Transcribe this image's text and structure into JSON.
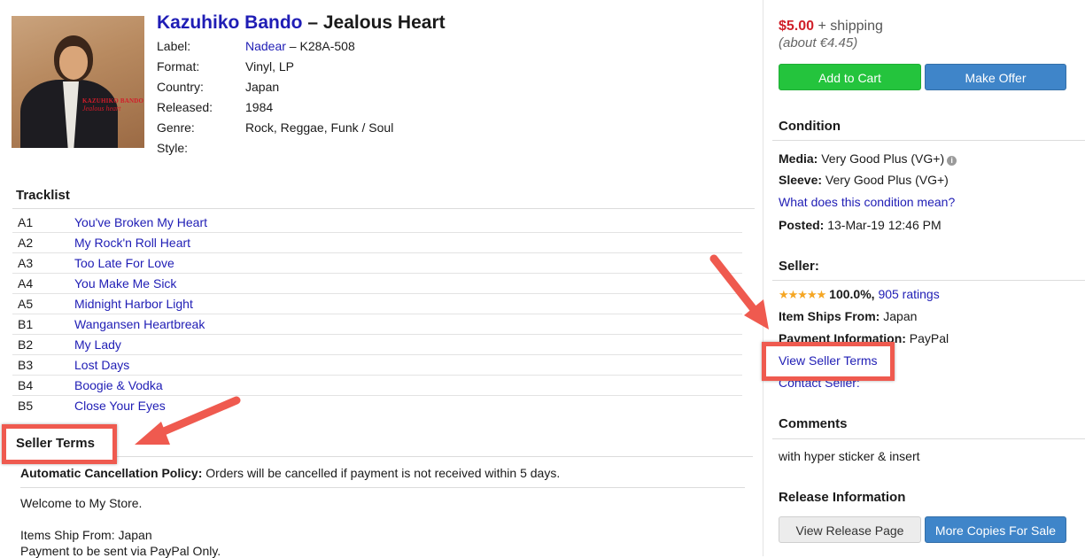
{
  "release": {
    "artist": "Kazuhiko Bando",
    "separator": " – ",
    "title": "Jealous Heart",
    "cover": {
      "artist_text": "KAZUHIKO BANDO",
      "title_text": "Jealous heart"
    },
    "meta": [
      {
        "key": "Label:",
        "value_link": "Nadear",
        "value_rest": " – K28A-508"
      },
      {
        "key": "Format:",
        "value": "Vinyl, LP"
      },
      {
        "key": "Country:",
        "value": "Japan"
      },
      {
        "key": "Released:",
        "value": "1984"
      },
      {
        "key": "Genre:",
        "value": "Rock, Reggae, Funk / Soul"
      },
      {
        "key": "Style:",
        "value": ""
      }
    ]
  },
  "tracklist": {
    "heading": "Tracklist",
    "tracks": [
      {
        "pos": "A1",
        "title": "You've Broken My Heart"
      },
      {
        "pos": "A2",
        "title": "My Rock'n Roll Heart"
      },
      {
        "pos": "A3",
        "title": "Too Late For Love"
      },
      {
        "pos": "A4",
        "title": "You Make Me Sick"
      },
      {
        "pos": "A5",
        "title": "Midnight Harbor Light"
      },
      {
        "pos": "B1",
        "title": "Wangansen Heartbreak"
      },
      {
        "pos": "B2",
        "title": "My Lady"
      },
      {
        "pos": "B3",
        "title": "Lost Days"
      },
      {
        "pos": "B4",
        "title": "Boogie & Vodka"
      },
      {
        "pos": "B5",
        "title": "Close Your Eyes"
      }
    ]
  },
  "seller_terms": {
    "heading": "Seller Terms",
    "policy_label": "Automatic Cancellation Policy:",
    "policy_text": " Orders will be cancelled if payment is not received within 5 days.",
    "welcome": "Welcome to My Store.",
    "ships_from": "Items Ship From: Japan",
    "payment": "Payment to be sent via PayPal Only."
  },
  "purchase": {
    "price": "$5.00",
    "shipping": " + shipping",
    "approx": "(about €4.45)",
    "add_to_cart": "Add to Cart",
    "make_offer": "Make Offer"
  },
  "condition": {
    "heading": "Condition",
    "media_label": "Media:",
    "media_value": " Very Good Plus (VG+)",
    "sleeve_label": "Sleeve:",
    "sleeve_value": " Very Good Plus (VG+)",
    "help_link": "What does this condition mean?",
    "posted_label": "Posted:",
    "posted_value": " 13-Mar-19 12:46 PM"
  },
  "seller": {
    "heading": "Seller:",
    "stars": "★★★★★",
    "rating": "100.0%,",
    "ratings_link": "905 ratings",
    "ships_label": "Item Ships From:",
    "ships_value": " Japan",
    "payment_label": "Payment Information:",
    "payment_value": " PayPal",
    "view_terms": "View Seller Terms",
    "contact": "Contact Seller:"
  },
  "comments": {
    "heading": "Comments",
    "text": "with hyper sticker & insert"
  },
  "release_info": {
    "heading": "Release Information",
    "view_release": "View Release Page",
    "more_copies": "More Copies For Sale"
  },
  "colors": {
    "price": "#d0202a",
    "link": "#1f1db5",
    "annotation": "#ef5a4f",
    "green_button": "#24c43d",
    "blue_button": "#3f85c9"
  }
}
